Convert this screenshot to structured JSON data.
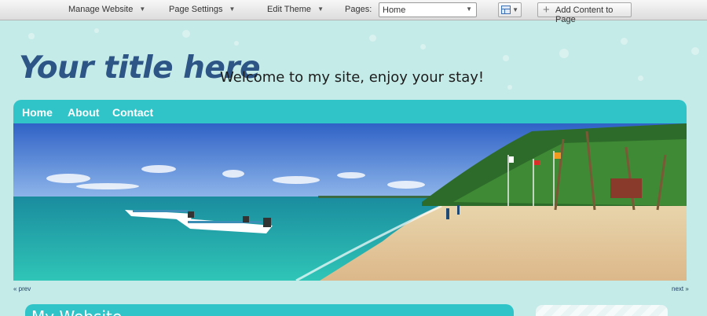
{
  "toolbar": {
    "manage_website": "Manage Website",
    "page_settings": "Page Settings",
    "edit_theme": "Edit Theme",
    "pages_label": "Pages:",
    "pages_value": "Home",
    "add_content": "Add Content to Page",
    "caret_icon": "chevron-down-icon",
    "layout_icon": "layout-grid-icon",
    "add_icon": "plus-icon"
  },
  "header": {
    "title": "Your title here",
    "tagline": "Welcome to my site, enjoy your stay!"
  },
  "nav": {
    "items": [
      "Home",
      "About",
      "Contact"
    ]
  },
  "slider": {
    "prev": "« prev",
    "next": "next »"
  },
  "content": {
    "title": "My Website"
  },
  "colors": {
    "accent": "#30c4c9",
    "background": "#c5ebe8",
    "title": "#2d5585"
  }
}
